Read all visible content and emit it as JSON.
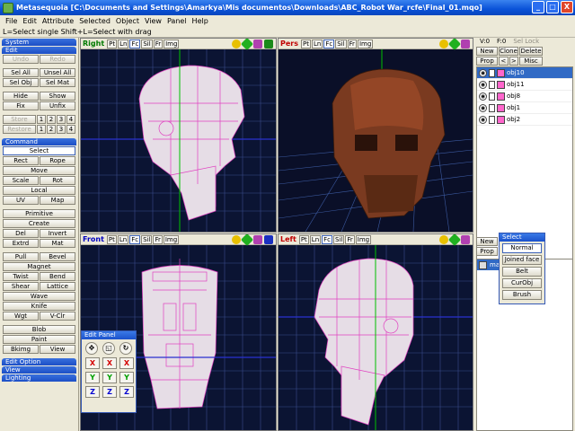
{
  "window": {
    "title": "Metasequoia [C:\\Documents and Settings\\Amarkya\\Mis documentos\\Downloads\\ABC_Robot War_rcfe\\Final_01.mqo]",
    "buttons": [
      "_",
      "□",
      "X"
    ]
  },
  "menu": [
    "File",
    "Edit",
    "Attribute",
    "Selected",
    "Object",
    "View",
    "Panel",
    "Help"
  ],
  "status_line": "L=Select single  Shift+L=Select with drag",
  "left_panel": {
    "system_header": "System",
    "edit_header": "Edit",
    "undo": "Undo",
    "redo": "Redo",
    "sel_all": "Sel All",
    "unsel_all": "Unsel All",
    "sel_obj": "Sel Obj",
    "sel_mat": "Sel Mat",
    "hide": "Hide",
    "show": "Show",
    "fix": "Fix",
    "unfix": "Unfix",
    "store": "Store",
    "restore": "Restore",
    "slots": [
      "1",
      "2",
      "3",
      "4"
    ],
    "command_header": "Command",
    "select": "Select",
    "rect": "Rect",
    "rope": "Rope",
    "move": "Move",
    "scale": "Scale",
    "rot": "Rot",
    "local": "Local",
    "uv": "UV",
    "map": "Map",
    "primitive": "Primitive",
    "create": "Create",
    "del": "Del",
    "invert": "Invert",
    "extrd": "Extrd",
    "mat": "Mat",
    "pull": "Pull",
    "bevel": "Bevel",
    "magnet": "Magnet",
    "twist": "Twist",
    "bend": "Bend",
    "shear": "Shear",
    "lattice": "Lattice",
    "wave": "Wave",
    "knife": "Knife",
    "wgt": "Wgt",
    "vclr": "V-Clr",
    "blob": "Blob",
    "paint": "Paint",
    "bkimg": "Bkimg",
    "view": "View",
    "edit_option_header": "Edit Option",
    "view_header": "View",
    "lighting_header": "Lighting"
  },
  "viewports": [
    {
      "name": "Right",
      "btns": [
        "Pt",
        "Ln",
        "Fc",
        "Sil",
        "Fr",
        "Img"
      ],
      "active": "Fc"
    },
    {
      "name": "Pers",
      "btns": [
        "Pt",
        "Ln",
        "Fc",
        "Sil",
        "Fr",
        "Img"
      ],
      "active": "Fc"
    },
    {
      "name": "Front",
      "btns": [
        "Pt",
        "Ln",
        "Fc",
        "Sil",
        "Fr",
        "Img"
      ],
      "active": "Fc"
    },
    {
      "name": "Left",
      "btns": [
        "Pt",
        "Ln",
        "Fc",
        "Sil",
        "Fr",
        "Img"
      ],
      "active": "Fc"
    }
  ],
  "right_panel": {
    "v_label": "V:0",
    "f_label": "F:0",
    "sel_lock": "Sel Lock",
    "new": "New",
    "clone": "Clone",
    "delete": "Delete",
    "prop": "Prop",
    "prev": "<",
    "next": ">",
    "misc": "Misc",
    "objects": [
      "obj10",
      "obj11",
      "obj8",
      "obj1",
      "obj2"
    ],
    "mat_new": "New",
    "mat_prop": "Prop",
    "material": "ma"
  },
  "select_popup": {
    "title": "Select",
    "items": [
      "Normal",
      "Joined face",
      "Belt",
      "CurObj",
      "Brush"
    ]
  },
  "edit_panel": {
    "title": "Edit Panel",
    "x": "X",
    "y": "Y",
    "z": "Z"
  },
  "colors": {
    "mesh": "#e8dfe8",
    "wire": "#e040c0",
    "grid": "#4a5a9a",
    "pers_bg": "#0a0f28",
    "ortho_bg": "#0b1433"
  }
}
